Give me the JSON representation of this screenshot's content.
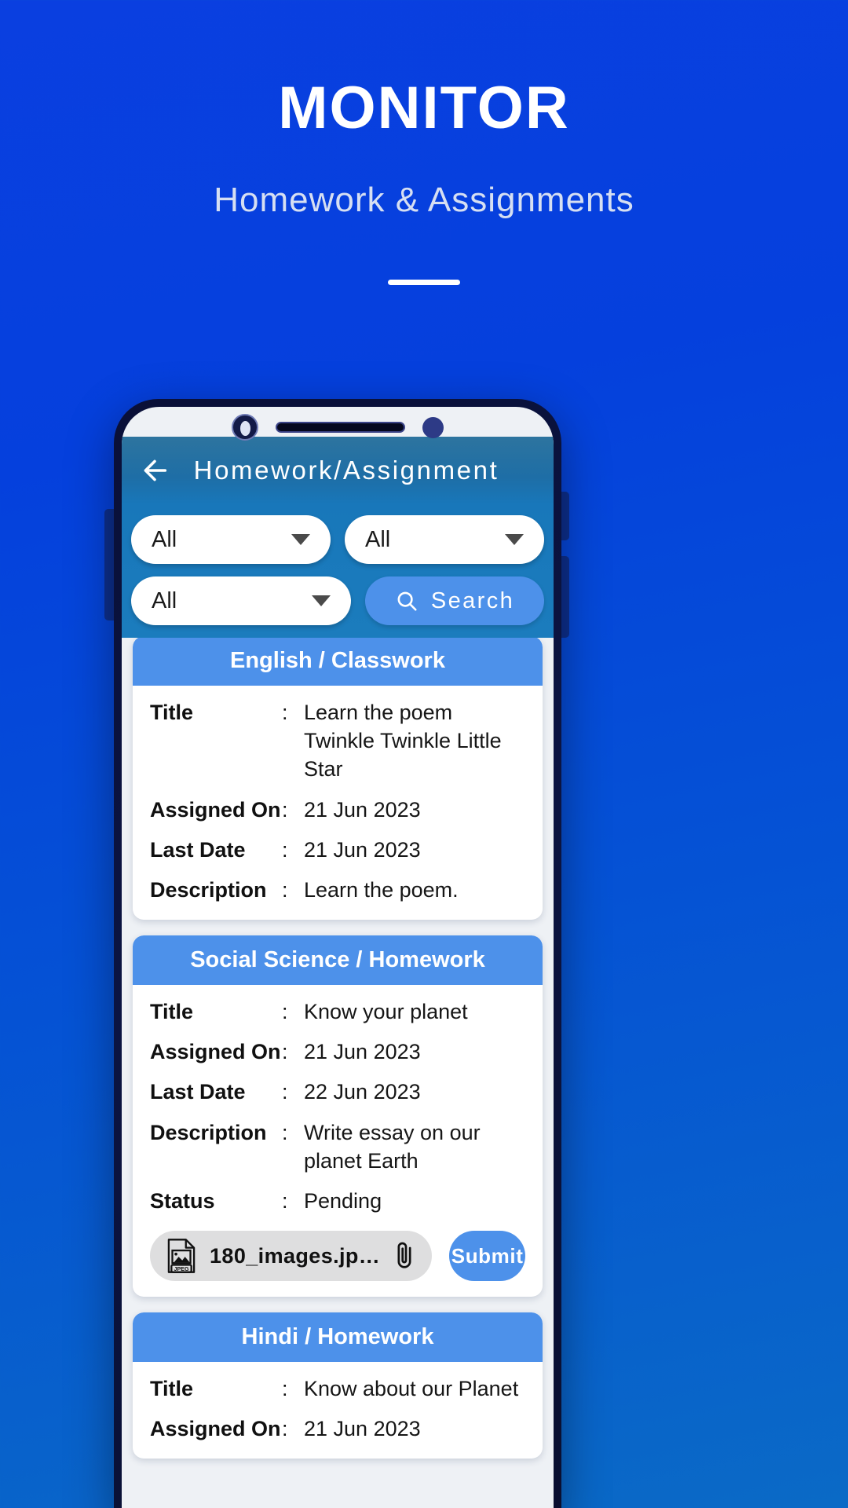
{
  "hero": {
    "title": "MONITOR",
    "subtitle": "Homework & Assignments"
  },
  "colors": {
    "background_top": "#0a3fe0",
    "background_bottom": "#0a6ac6",
    "app_header": "#1877ba",
    "accent": "#4d91ea",
    "card_background": "#ffffff",
    "chip_background": "#dededf"
  },
  "phone": {
    "app_header": {
      "back_icon": "back-arrow-icon",
      "title": "Homework/Assignment"
    },
    "filters": {
      "dropdown_1": "All",
      "dropdown_2": "All",
      "dropdown_3": "All",
      "search_label": "Search",
      "search_icon": "search-icon",
      "caret_icon": "chevron-down-icon"
    },
    "cards": [
      {
        "header": "English / Classwork",
        "rows": [
          {
            "key": "Title",
            "sep": ":",
            "value": "Learn the poem Twinkle Twinkle Little Star"
          },
          {
            "key": "Assigned On",
            "sep": ":",
            "value": "21 Jun 2023"
          },
          {
            "key": "Last Date",
            "sep": ":",
            "value": "21 Jun 2023"
          },
          {
            "key": "Description",
            "sep": ":",
            "value": "Learn the poem."
          }
        ],
        "attachment": null
      },
      {
        "header": "Social Science / Homework",
        "rows": [
          {
            "key": "Title",
            "sep": ":",
            "value": "Know your planet"
          },
          {
            "key": "Assigned On",
            "sep": ":",
            "value": "21 Jun 2023"
          },
          {
            "key": "Last Date",
            "sep": ":",
            "value": "22 Jun 2023"
          },
          {
            "key": "Description",
            "sep": ":",
            "value": "Write essay on our planet Earth"
          },
          {
            "key": "Status",
            "sep": ":",
            "value": "Pending"
          }
        ],
        "attachment": {
          "file_icon": "jpeg-file-icon",
          "file_name": "180_images.jp…",
          "clip_icon": "paperclip-icon",
          "submit_label": "Submit"
        }
      },
      {
        "header": "Hindi / Homework",
        "rows": [
          {
            "key": "Title",
            "sep": ":",
            "value": "Know about our Planet"
          },
          {
            "key": "Assigned On",
            "sep": ":",
            "value": "21 Jun 2023"
          }
        ],
        "attachment": null
      }
    ]
  }
}
